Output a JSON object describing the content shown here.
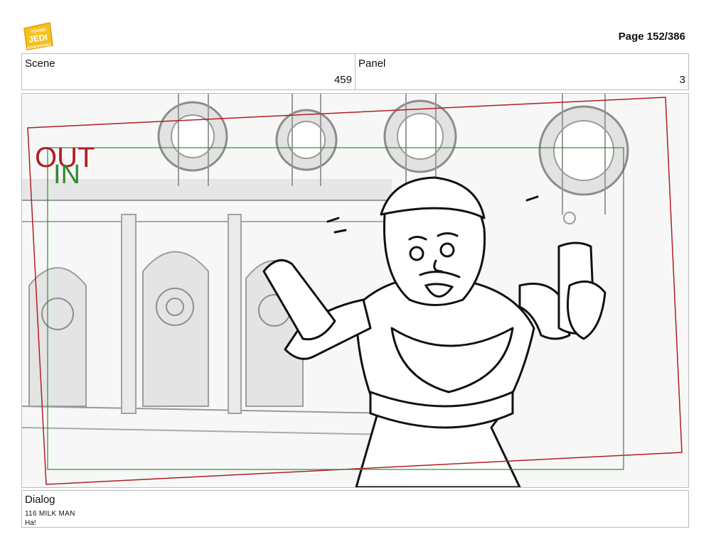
{
  "header": {
    "logo_text": "YOUNG JEDI ADVENTURES",
    "page_label": "Page 152/386"
  },
  "meta": {
    "scene_label": "Scene",
    "scene_value": "459",
    "panel_label": "Panel",
    "panel_value": "3"
  },
  "panel_image": {
    "out_label": "OUT",
    "in_label": "IN",
    "out_color": "#b01e24",
    "in_color": "#2e8b2e"
  },
  "dialog": {
    "label": "Dialog",
    "speaker": "116 MILK MAN",
    "line": "Ha!"
  }
}
